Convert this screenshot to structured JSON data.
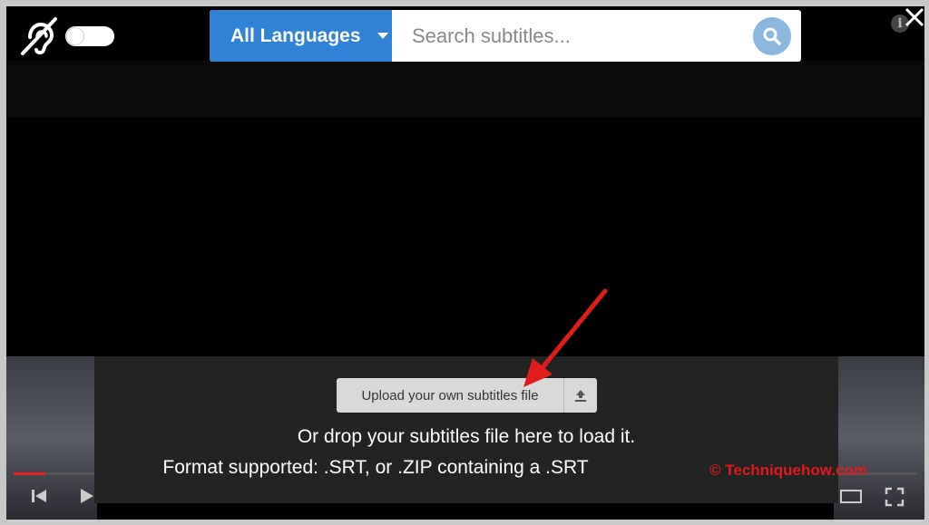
{
  "search": {
    "language_label": "All Languages",
    "placeholder": "Search subtitles..."
  },
  "upload": {
    "button_label": "Upload your own subtitles file",
    "hint_line1": "Or drop your subtitles file here to load it.",
    "hint_line2": "Format supported: .SRT, or .ZIP containing a .SRT"
  },
  "watermark": "© Techniquehow.com",
  "icons": [
    "hearing-accessibility-icon",
    "search-icon",
    "info-icon",
    "close-icon",
    "upload-icon",
    "skip-previous-icon",
    "play-icon",
    "fullscreen-icon",
    "theater-mode-icon"
  ],
  "colors": {
    "accent": "#2f82d6",
    "panel": "#232323",
    "arrow": "#e21b1b"
  },
  "player": {
    "progress_fraction": 0.035
  }
}
